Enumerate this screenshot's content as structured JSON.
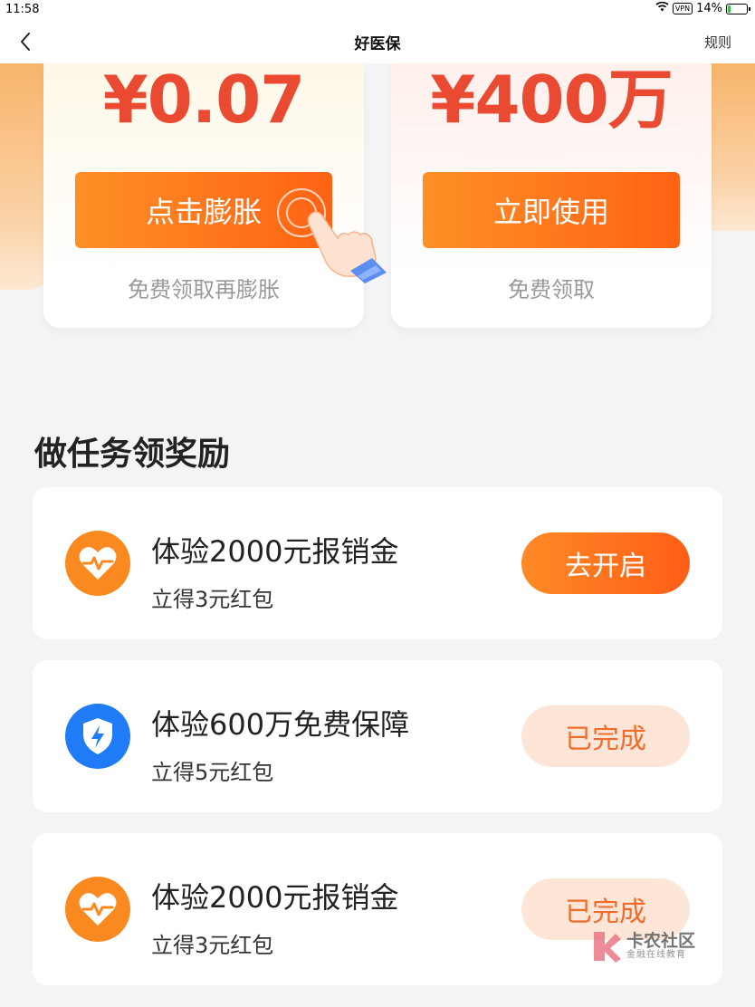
{
  "status_bar": {
    "time": "11:58",
    "vpn": "VPN",
    "battery": "14%",
    "battery_level": 0.14
  },
  "nav": {
    "title": "好医保",
    "rules": "规则"
  },
  "cards": [
    {
      "amount": "¥0.07",
      "button": "点击膨胀",
      "sub": "免费领取再膨胀"
    },
    {
      "amount": "¥400万",
      "button": "立即使用",
      "sub": "免费领取"
    }
  ],
  "section_title": "做任务领奖励",
  "tasks": [
    {
      "title": "体验2000元报销金",
      "sub": "立得3元红包",
      "button": "去开启",
      "icon": "heart-pulse-icon",
      "icon_color": "#fa8a1f",
      "status": "active"
    },
    {
      "title": "体验600万免费保障",
      "sub": "立得5元红包",
      "button": "已完成",
      "icon": "shield-bolt-icon",
      "icon_color": "#1f7cf6",
      "status": "done"
    },
    {
      "title": "体验2000元报销金",
      "sub": "立得3元红包",
      "button": "已完成",
      "icon": "heart-pulse-icon",
      "icon_color": "#fa8a1f",
      "status": "done"
    }
  ],
  "watermark": {
    "name": "卡农社区",
    "sub": "金融在线教育"
  },
  "colors": {
    "accent": "#ff6a1a",
    "amount": "#ea4a32",
    "done_bg": "#fde6d8"
  }
}
